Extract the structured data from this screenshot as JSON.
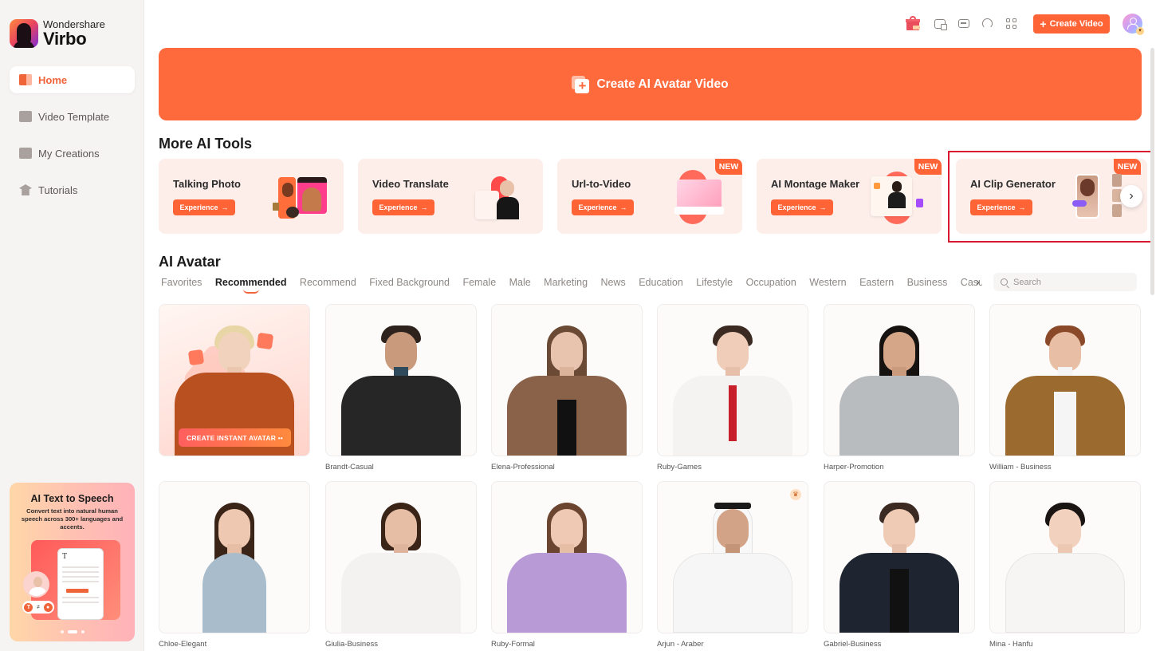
{
  "app": {
    "brand": "Wondershare",
    "name": "Virbo"
  },
  "sidebar": {
    "items": [
      {
        "label": "Home",
        "icon": "home-icon",
        "active": true
      },
      {
        "label": "Video Template",
        "icon": "video-template-icon",
        "active": false
      },
      {
        "label": "My Creations",
        "icon": "my-creations-icon",
        "active": false
      },
      {
        "label": "Tutorials",
        "icon": "tutorials-icon",
        "active": false
      }
    ],
    "promo": {
      "title": "AI Text to Speech",
      "description": "Convert text into natural human speech across 300+ languages and accents.",
      "carousel_total": 3,
      "carousel_active": 2
    }
  },
  "topbar": {
    "icons": [
      "gift-icon",
      "screen-record-icon",
      "feedback-icon",
      "support-headset-icon",
      "apps-grid-icon"
    ],
    "create_video_label": "Create Video",
    "accent_color": "#ff6437"
  },
  "hero": {
    "label": "Create AI Avatar Video",
    "color": "#ff6a3d"
  },
  "more_tools": {
    "title": "More AI Tools",
    "button_label": "Experience",
    "badge_label": "NEW",
    "items": [
      {
        "name": "Talking Photo",
        "is_new": false
      },
      {
        "name": "Video Translate",
        "is_new": false
      },
      {
        "name": "Url-to-Video",
        "is_new": true
      },
      {
        "name": "AI Montage Maker",
        "is_new": true
      },
      {
        "name": "AI Clip Generator",
        "is_new": true,
        "highlighted": true
      }
    ]
  },
  "avatars": {
    "title": "AI Avatar",
    "tabs": [
      "Favorites",
      "Recommended",
      "Recommend",
      "Fixed Background",
      "Female",
      "Male",
      "Marketing",
      "News",
      "Education",
      "Lifestyle",
      "Occupation",
      "Western",
      "Eastern",
      "Business",
      "Casual"
    ],
    "active_tab": "Recommended",
    "search_placeholder": "Search",
    "instant_avatar_label": "CREATE INSTANT AVATAR ••",
    "items": [
      {
        "name": "Brandt-Casual"
      },
      {
        "name": "Elena-Professional"
      },
      {
        "name": "Ruby-Games"
      },
      {
        "name": "Harper-Promotion"
      },
      {
        "name": "William - Business"
      },
      {
        "name": "Chloe-Elegant"
      },
      {
        "name": "Giulia-Business"
      },
      {
        "name": "Ruby-Formal"
      },
      {
        "name": "Arjun - Araber",
        "premium": true
      },
      {
        "name": "Gabriel-Business"
      },
      {
        "name": "Mina - Hanfu"
      }
    ]
  }
}
